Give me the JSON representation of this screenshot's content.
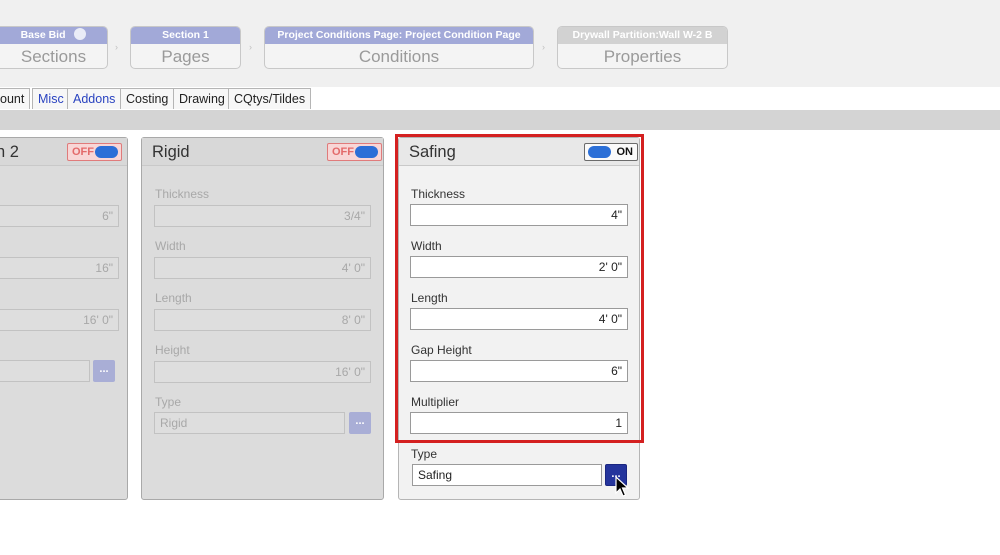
{
  "breadcrumbs": [
    {
      "header": "Base Bid",
      "label": "Sections"
    },
    {
      "header": "Section 1",
      "label": "Pages"
    },
    {
      "header": "Project Conditions Page: Project Condition Page",
      "label": "Conditions"
    },
    {
      "header": "Drywall Partition:Wall W-2 B",
      "label": "Properties"
    }
  ],
  "tabs": [
    "ount",
    "Misc",
    "Addons",
    "Costing",
    "Drawing",
    "CQtys/Tildes"
  ],
  "panels": {
    "left": {
      "title": "n 2",
      "toggle": "OFF",
      "values": [
        "6\"",
        "16\"",
        "16' 0\""
      ]
    },
    "rigid": {
      "title": "Rigid",
      "toggle": "OFF",
      "fields": [
        {
          "label": "Thickness",
          "value": "3/4\""
        },
        {
          "label": "Width",
          "value": "4' 0\""
        },
        {
          "label": "Length",
          "value": "8' 0\""
        },
        {
          "label": "Height",
          "value": "16' 0\""
        }
      ],
      "type_label": "Type",
      "type_value": "Rigid"
    },
    "safing": {
      "title": "Safing",
      "toggle": "ON",
      "fields": [
        {
          "label": "Thickness",
          "value": "4\""
        },
        {
          "label": "Width",
          "value": "2' 0\""
        },
        {
          "label": "Length",
          "value": "4' 0\""
        },
        {
          "label": "Gap Height",
          "value": "6\""
        },
        {
          "label": "Multiplier",
          "value": "1"
        }
      ],
      "type_label": "Type",
      "type_value": "Safing"
    }
  },
  "ellipsis": "...",
  "colors": {
    "crumb_active": "#a2a9d8",
    "crumb_inactive": "#d2d2d2",
    "highlight": "#d42020",
    "toggle_knob": "#2b6fd7",
    "button_dark": "#24349c"
  }
}
